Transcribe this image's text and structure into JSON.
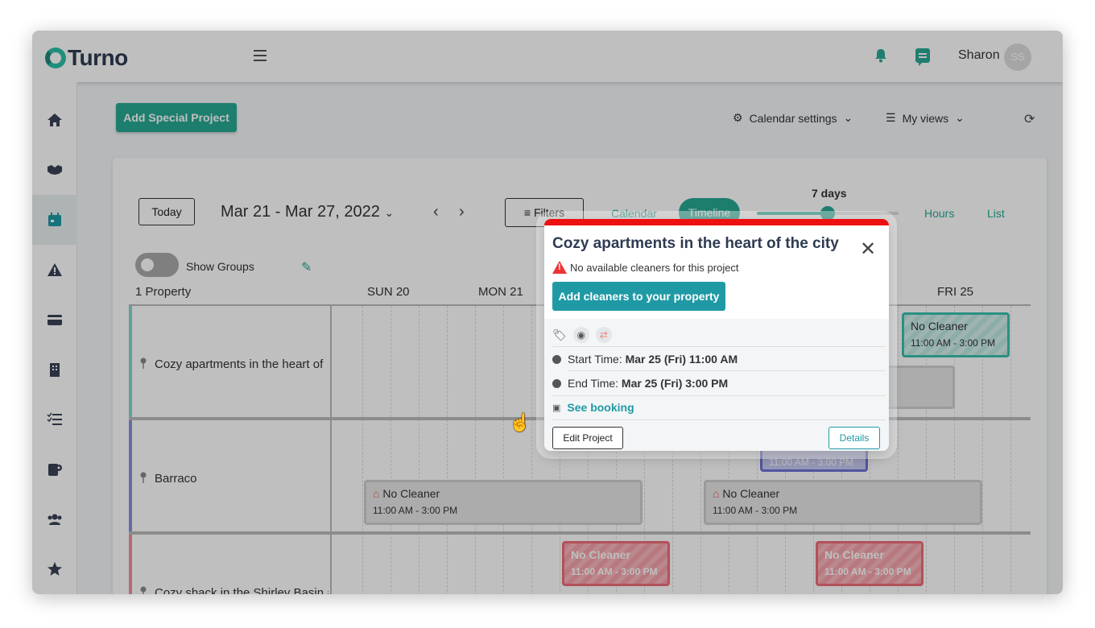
{
  "app": {
    "logo_text": "Turno",
    "user_name": "Sharon",
    "user_initials": "SS",
    "accent": "#27a893"
  },
  "toolbar": {
    "add_special_project": "Add Special Project",
    "calendar_settings": "Calendar settings",
    "my_views": "My views"
  },
  "calendar": {
    "today": "Today",
    "date_range": "Mar 21 - Mar 27, 2022",
    "filters": "Filters",
    "view_calendar": "Calendar",
    "view_timeline": "Timeline",
    "range_label": "7 days",
    "range_fill_fraction": 0.5,
    "view_hours": "Hours",
    "view_list": "List",
    "show_groups": "Show Groups",
    "property_count": "1 Property",
    "days": [
      "SUN 20",
      "MON 21",
      "FRI 25"
    ]
  },
  "rows": [
    {
      "name": "Cozy apartments in the heart of",
      "color": "#7fd8c8"
    },
    {
      "name": "Barraco",
      "color": "#8a8ee0"
    },
    {
      "name": "Cozy shack in the Shirley Basin a",
      "color": "#f08f98"
    }
  ],
  "events": {
    "no_cleaner": "No Cleaner",
    "time": "11:00 AM - 3:00 PM"
  },
  "popup": {
    "title": "Cozy apartments in the heart of the city",
    "warning": "No available cleaners for this project",
    "add_cleaners": "Add cleaners to your property",
    "start_label": "Start Time:",
    "start_value": "Mar 25 (Fri) 11:00 AM",
    "end_label": "End Time:",
    "end_value": "Mar 25 (Fri) 3:00 PM",
    "see_booking": "See booking",
    "edit_project": "Edit Project",
    "details": "Details"
  }
}
